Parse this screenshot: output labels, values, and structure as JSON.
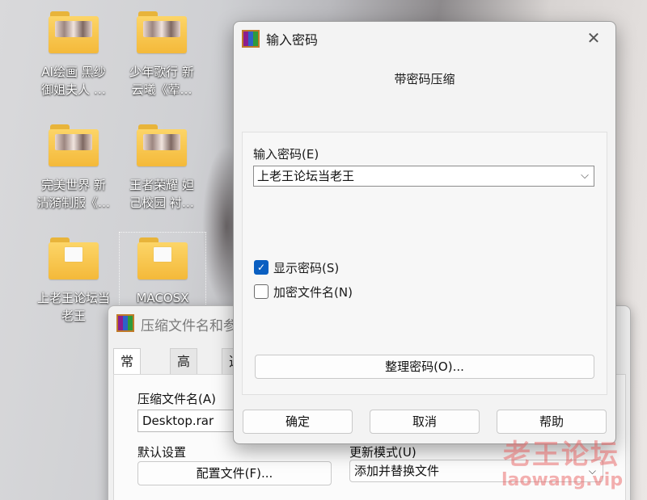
{
  "desktop": {
    "icons": [
      {
        "label_line1": "AI绘画  黑纱",
        "label_line2": "御姐夫人 …",
        "kind": "thumb"
      },
      {
        "label_line1": "少年歌行 新",
        "label_line2": "云曦《荤…",
        "kind": "thumb"
      },
      {
        "label_line1": "完美世界 新",
        "label_line2": "清漪制服《…",
        "kind": "thumb"
      },
      {
        "label_line1": "王者荣耀  妲",
        "label_line2": "己校园 衬…",
        "kind": "thumb"
      },
      {
        "label_line1": "上老王论坛当",
        "label_line2": "老王",
        "kind": "paper"
      },
      {
        "label_line1": "MACOSX",
        "label_line2": "",
        "kind": "paper"
      }
    ]
  },
  "rar_dialog": {
    "title": "压缩文件名和参",
    "tabs": [
      "常规",
      "高级",
      "选"
    ],
    "archive_name_label": "压缩文件名(A)",
    "archive_name_value": "Desktop.rar",
    "default_settings_label": "默认设置",
    "profiles_button": "配置文件(F)...",
    "update_mode_label": "更新模式(U)",
    "update_mode_value": "添加并替换文件"
  },
  "password_dialog": {
    "title": "输入密码",
    "heading": "带密码压缩",
    "enter_password_label": "输入密码(E)",
    "password_value": "上老王论坛当老王",
    "show_password_label": "显示密码(S)",
    "show_password_checked": true,
    "encrypt_filenames_label": "加密文件名(N)",
    "encrypt_filenames_checked": false,
    "organize_button": "整理密码(O)...",
    "ok_button": "确定",
    "cancel_button": "取消",
    "help_button": "帮助"
  },
  "watermark": {
    "text": "老王论坛",
    "url": "laowang.vip"
  },
  "colors": {
    "accent": "#0a5fc1",
    "folder": "#f4b93a"
  }
}
